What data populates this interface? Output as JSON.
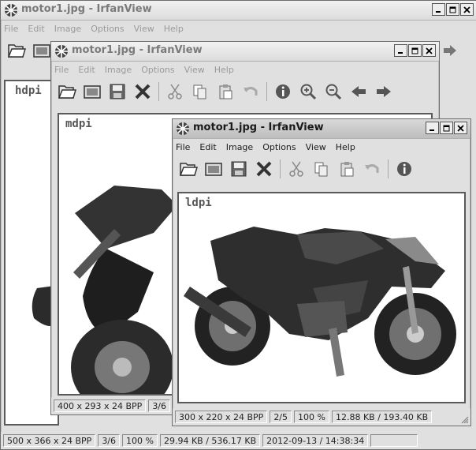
{
  "app_title": "motor1.jpg - IrfanView",
  "menu": [
    "File",
    "Edit",
    "Image",
    "Options",
    "View",
    "Help"
  ],
  "window_buttons": {
    "minimize": "_",
    "maximize": "□",
    "close": "X"
  },
  "windows": {
    "hdpi": {
      "label": "hdpi",
      "status": [
        "500 x 366 x 24 BPP",
        "3/6",
        "100 %",
        "29.94 KB / 536.17 KB",
        "2012-09-13 / 14:38:34"
      ]
    },
    "mdpi": {
      "label": "mdpi",
      "status": [
        "400 x 293 x 24 BPP",
        "3/6"
      ]
    },
    "ldpi": {
      "label": "ldpi",
      "status": [
        "300 x 220 x 24 BPP",
        "2/5",
        "100 %",
        "12.88 KB / 193.40 KB"
      ]
    }
  },
  "toolbar_icons": [
    "open-icon",
    "slideshow-icon",
    "save-icon",
    "delete-icon",
    "cut-icon",
    "copy-icon",
    "paste-icon",
    "undo-icon",
    "info-icon",
    "zoom-in-icon",
    "zoom-out-icon",
    "previous-icon",
    "next-icon"
  ],
  "colors": {
    "motorcycle_body": "#2b2b2b",
    "panel": "#e0e0e0",
    "canvas": "#ffffff"
  }
}
